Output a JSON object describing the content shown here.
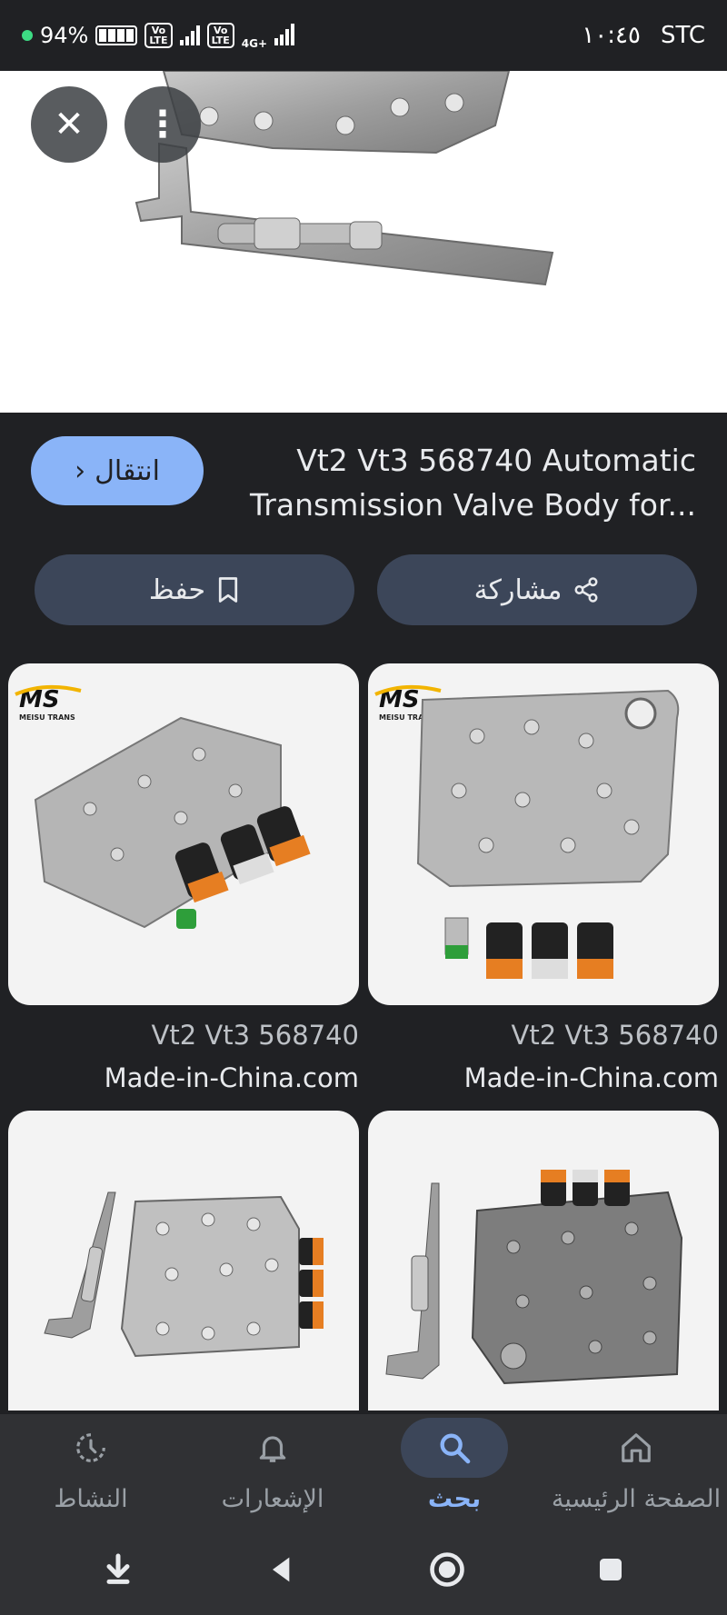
{
  "status": {
    "battery": "94%",
    "volte_label": "Vo LTE",
    "network": "4G+",
    "time": "١٠:٤٥",
    "carrier": "STC"
  },
  "hero": {
    "close_icon": "close-icon",
    "menu_icon": "more-vert-icon"
  },
  "result": {
    "title_line1": "Vt2 Vt3 568740 Automatic",
    "title_line2": "Transmission Valve Body for...",
    "go_label": "انتقال",
    "share_label": "مشاركة",
    "save_label": "حفظ"
  },
  "related": [
    {
      "title": "Vt2 Vt3 568740",
      "source": "Made-in-China.com",
      "logo": "MS",
      "logo_sub": "MEISU TRANS"
    },
    {
      "title": "Vt2 Vt3 568740",
      "source": "Made-in-China.com",
      "logo": "MS",
      "logo_sub": "MEISU TRANS"
    }
  ],
  "bottom_nav": [
    {
      "label": "الصفحة الرئيسية",
      "icon": "home-icon"
    },
    {
      "label": "بحث",
      "icon": "search-icon"
    },
    {
      "label": "الإشعارات",
      "icon": "bell-icon"
    },
    {
      "label": "النشاط",
      "icon": "activity-icon"
    }
  ],
  "colors": {
    "background": "#202124",
    "accent": "#8ab4f8",
    "button": "#3c4659",
    "nav": "#303134"
  }
}
